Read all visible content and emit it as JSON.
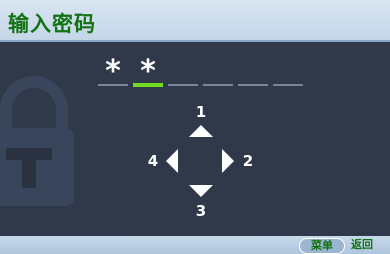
{
  "title": "输入密码",
  "password": {
    "entered": [
      "*",
      "*"
    ],
    "slot_count": 6,
    "active_slot": 2
  },
  "directions": {
    "up": "1",
    "right": "2",
    "down": "3",
    "left": "4"
  },
  "footer": {
    "menu_button": "菜单",
    "action_label": "返回"
  },
  "colors": {
    "title_text": "#127212",
    "active_underline": "#72dc20",
    "background": "#30394a"
  }
}
